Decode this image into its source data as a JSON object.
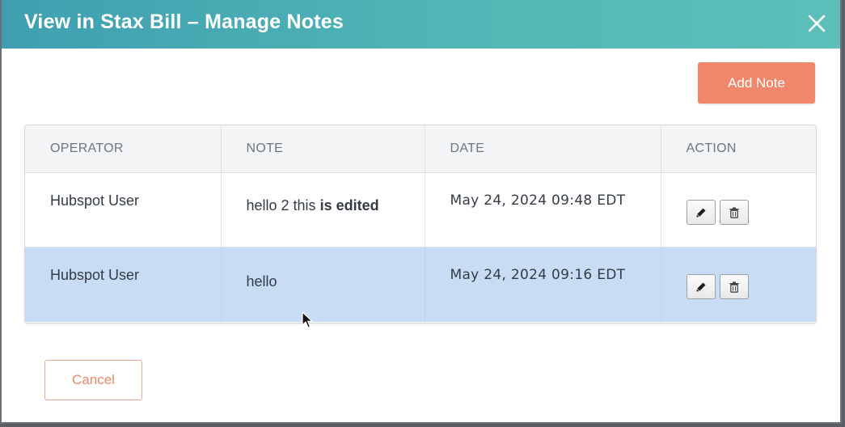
{
  "dialog": {
    "title": "View in Stax Bill – Manage Notes",
    "close_icon": "close-icon"
  },
  "toolbar": {
    "add_note_label": "Add Note"
  },
  "table": {
    "columns": [
      "OPERATOR",
      "NOTE",
      "DATE",
      "ACTION"
    ],
    "rows": [
      {
        "operator": "Hubspot User",
        "note_plain": "hello 2 this ",
        "note_bold": "is edited",
        "date": "May 24, 2024 09:48 EDT",
        "selected": false,
        "actions": [
          "pencil-icon",
          "trash-icon"
        ]
      },
      {
        "operator": "Hubspot User",
        "note_plain": "hello",
        "note_bold": "",
        "date": "May 24, 2024 09:16 EDT",
        "selected": true,
        "actions": [
          "pencil-icon",
          "trash-icon"
        ]
      }
    ]
  },
  "footer": {
    "cancel_label": "Cancel"
  },
  "colors": {
    "header_gradient_start": "#3f9fb0",
    "header_gradient_end": "#5cbfb9",
    "accent": "#f0866a",
    "selected_row": "#c8dcf6"
  }
}
